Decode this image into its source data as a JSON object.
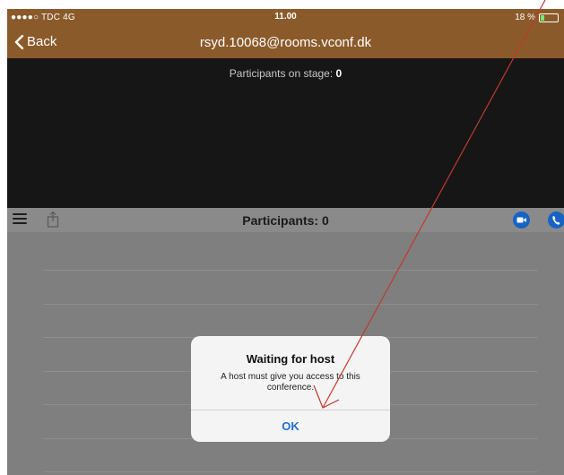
{
  "status_bar": {
    "carrier": "●●●●○ TDC  4G",
    "time": "11.00",
    "battery": "18 %"
  },
  "nav_bar": {
    "back_label": "Back",
    "title": "rsyd.10068@rooms.vconf.dk"
  },
  "stage": {
    "label": "Participants on stage:",
    "count": "0"
  },
  "participants_bar": {
    "title": "Participants: 0"
  },
  "alert": {
    "title": "Waiting for host",
    "message": "A host must give you access to this conference.",
    "ok_label": "OK"
  },
  "colors": {
    "nav_brown": "#8b5a2b",
    "stage_black": "#161616",
    "accent_blue": "#1763c4",
    "annotation_red": "#c0392b"
  },
  "icons": [
    "chevron-left-icon",
    "menu-icon",
    "share-icon",
    "video-icon",
    "phone-icon",
    "annotation-arrow"
  ]
}
